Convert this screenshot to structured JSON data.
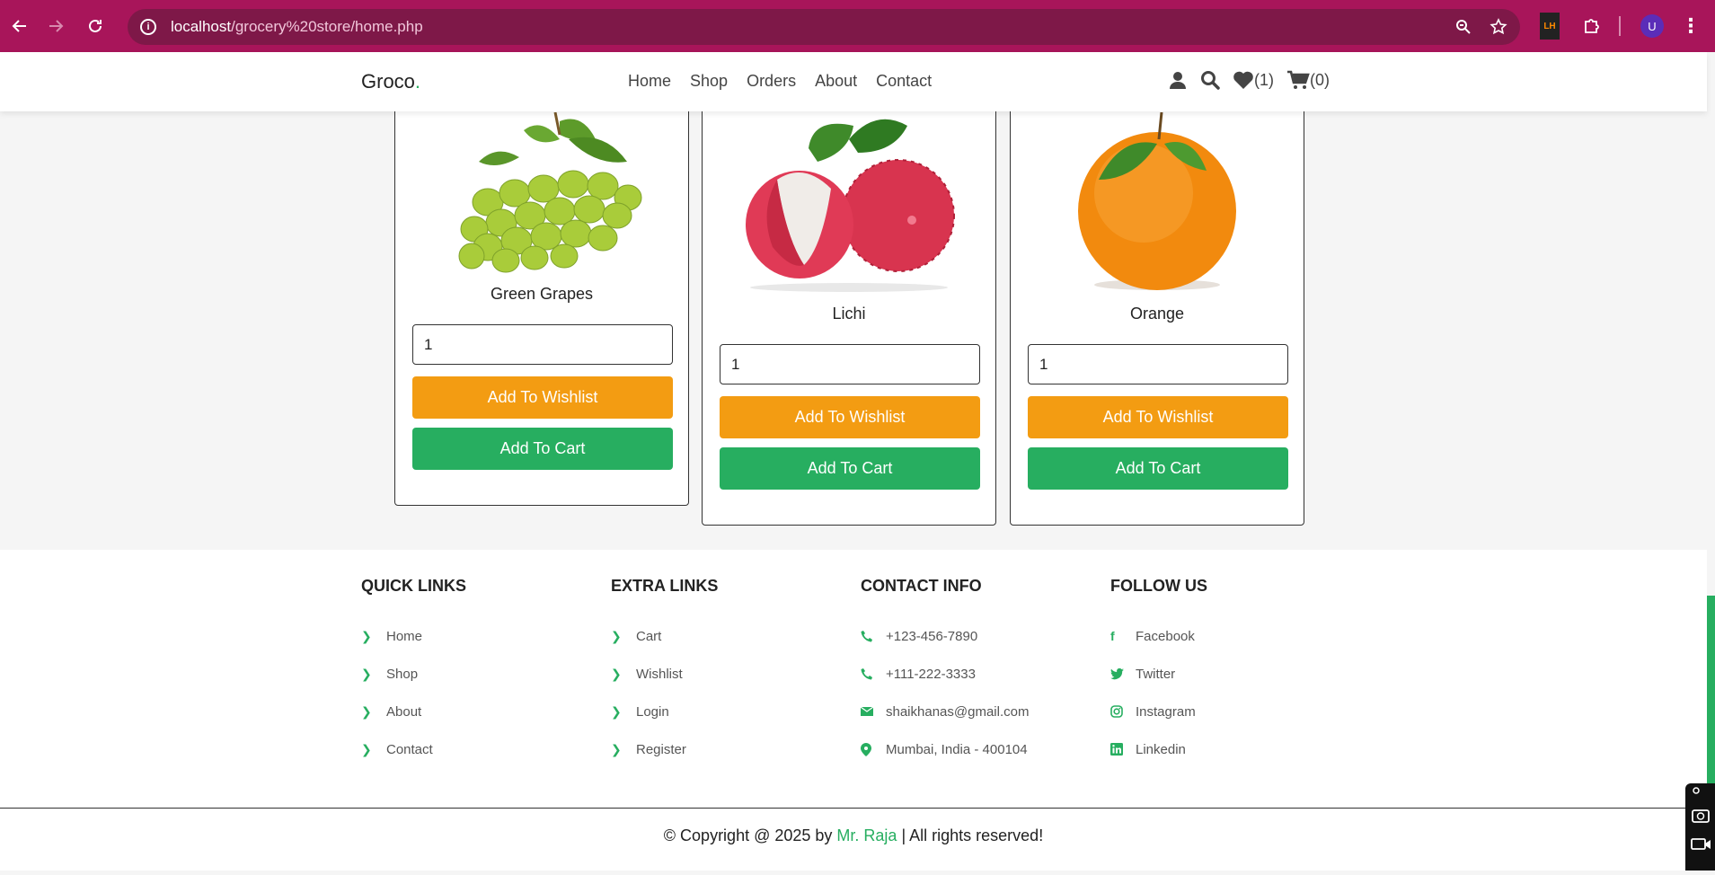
{
  "browser": {
    "url_host": "localhost",
    "url_path": "/grocery%20store/home.php",
    "profile_initial": "U",
    "ext_label": "LH"
  },
  "header": {
    "logo_text": "Groco",
    "logo_dot": ".",
    "nav": [
      "Home",
      "Shop",
      "Orders",
      "About",
      "Contact"
    ],
    "wishlist_count": "(1)",
    "cart_count": "(0)"
  },
  "products": [
    {
      "name": "Green Grapes",
      "qty": "1",
      "wishlist_label": "Add To Wishlist",
      "cart_label": "Add To Cart"
    },
    {
      "name": "Lichi",
      "qty": "1",
      "wishlist_label": "Add To Wishlist",
      "cart_label": "Add To Cart"
    },
    {
      "name": "Orange",
      "qty": "1",
      "wishlist_label": "Add To Wishlist",
      "cart_label": "Add To Cart"
    }
  ],
  "footer": {
    "quick_links": {
      "title": "QUICK LINKS",
      "items": [
        "Home",
        "Shop",
        "About",
        "Contact"
      ]
    },
    "extra_links": {
      "title": "EXTRA LINKS",
      "items": [
        "Cart",
        "Wishlist",
        "Login",
        "Register"
      ]
    },
    "contact_info": {
      "title": "CONTACT INFO",
      "items": [
        "+123-456-7890",
        "+111-222-3333",
        "shaikhanas@gmail.com",
        "Mumbai, India - 400104"
      ]
    },
    "follow_us": {
      "title": "FOLLOW US",
      "items": [
        "Facebook",
        "Twitter",
        "Instagram",
        "Linkedin"
      ]
    }
  },
  "copyright": {
    "prefix": "© Copyright @ 2025 by ",
    "author": "Mr. Raja",
    "suffix": " | All rights reserved!"
  },
  "colors": {
    "chrome": "#a8155a",
    "accent_green": "#27ae60",
    "wishlist_orange": "#f39c12",
    "price_red": "#e74c3c"
  }
}
